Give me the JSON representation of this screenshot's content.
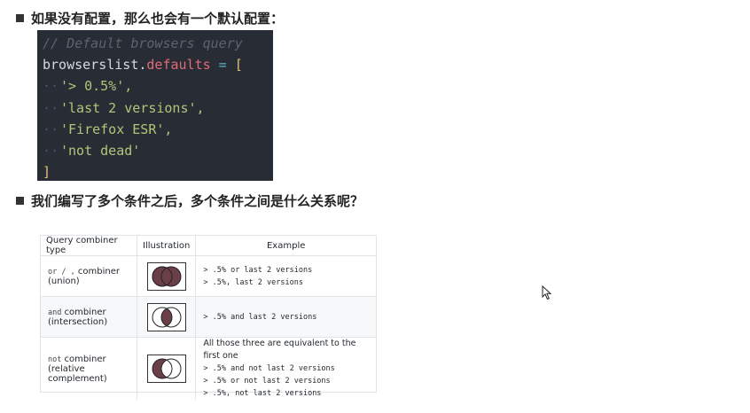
{
  "headings": {
    "first": "如果没有配置，那么也会有一个默认配置：",
    "second": "我们编写了多个条件之后，多个条件之间是什么关系呢？"
  },
  "code": {
    "comment": "// Default browsers query",
    "obj": "browserslist",
    "dot": ".",
    "prop": "defaults",
    "assign": " = ",
    "open": "[",
    "indent": "··",
    "items": [
      "'> 0.5%',",
      "'last 2 versions',",
      "'Firefox ESR',",
      "'not dead'"
    ],
    "close": "]"
  },
  "table": {
    "headers": [
      "Query combiner type",
      "Illustration",
      "Example"
    ],
    "rows": [
      {
        "type_code": "or / ,",
        "type_word": " combiner",
        "type_desc": "(union)",
        "illustration": "union-venn-icon",
        "examples": [
          "> .5% or last 2 versions",
          "> .5%, last 2 versions"
        ],
        "note": ""
      },
      {
        "type_code": "and",
        "type_word": " combiner",
        "type_desc": "(intersection)",
        "illustration": "intersection-venn-icon",
        "examples": [
          "> .5% and last 2 versions"
        ],
        "note": ""
      },
      {
        "type_code": "not",
        "type_word": " combiner",
        "type_desc": "(relative complement)",
        "illustration": "complement-venn-icon",
        "examples": [
          "> .5% and not last 2 versions",
          "> .5% or not last 2 versions",
          "> .5%, not last 2 versions"
        ],
        "note": "All those three are equivalent to the first one"
      }
    ]
  },
  "colors": {
    "venn_fill": "#6b3f48",
    "code_bg": "#282c34"
  }
}
